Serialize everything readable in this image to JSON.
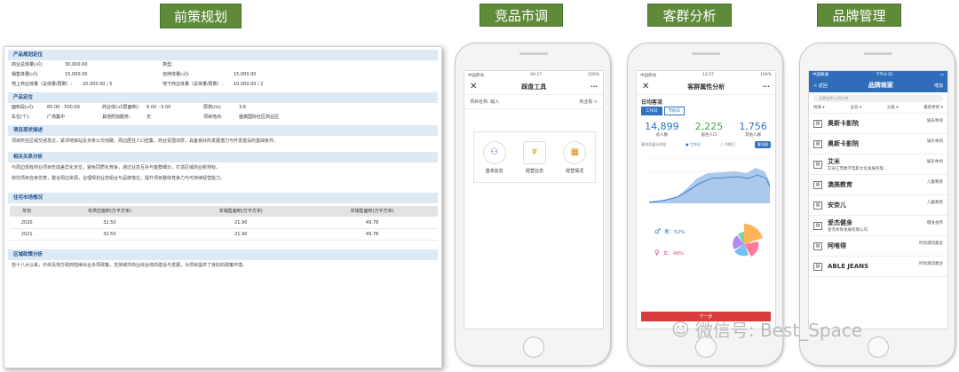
{
  "tags": {
    "t1": "前策规划",
    "t2": "竞品市调",
    "t3": "客群分析",
    "t4": "品牌管理"
  },
  "doc": {
    "sec1": "产品规划定位",
    "r1": [
      "商业总体量(㎡):",
      "30,000.00",
      "类型:",
      ""
    ],
    "r2": [
      "销售体量(㎡):",
      "15,000.00",
      "自持体量(㎡):",
      "15,000.00"
    ],
    "r3": [
      "地上商业体量（总体量/层数）:",
      "20,000.00 / 5",
      "地下商业体量（总体量/层数）:",
      "10,000.00 / 2"
    ],
    "sec2": "产品定位",
    "r4": [
      "面积段(㎡):",
      "60.00 - 500.00",
      "商业体(㎡/层面积):",
      "6.00 - 5.00",
      "层高(m):",
      "3.6"
    ],
    "r5": [
      "车位(个):",
      "广场集中",
      "其他附加服务:",
      "无",
      "项目地点:",
      "盛典国际社区商业区"
    ],
    "sec3": "项目现状描述",
    "p1": "项目所在区域交通发达，紧邻地铁站及多条公交线路，周边居住人口密集，商业氛围浓厚，具备良好的发展潜力与开发建设的基础条件。",
    "sec4": "相关关系分析",
    "p2": "与周边现有商业项目形成差异化定位，避免同质化竞争，通过业态互补与客群细分，打造区域商业新地标。",
    "p3": "依托项目自身优势，整合周边资源，合理规划业态组合与品牌落位，提升项目整体竞争力与可持续经营能力。",
    "sec5": "住宅市场情况",
    "table": {
      "headers": [
        "年份",
        "年供应面积(万平方米)",
        "年销售面积(万平方米)",
        "年销售面积(万平方米)"
      ],
      "rows": [
        [
          "2020",
          "32.50",
          "21.90",
          "49.78"
        ],
        [
          "2021",
          "32.50",
          "21.90",
          "49.78"
        ]
      ]
    },
    "sec6": "区域政策分析",
    "p4": "自十八大以来，中央及地方政府陆续出台多项政策，支持城市商业综合体的建设与发展，为项目提供了良好的政策环境。"
  },
  "s1": {
    "carrier": "中国移动",
    "time": "00:17",
    "battery": "100%",
    "title": "踩盘工具",
    "more": "···",
    "field_label": "项目名称: 输入",
    "field_value": "商业街 >",
    "tiles": [
      "基本信息",
      "经营业态",
      "经营情况"
    ]
  },
  "s2": {
    "carrier": "中国移动",
    "time": "12:57",
    "battery": "100%",
    "title": "客群属性分析",
    "more": "···",
    "subtitle": "日均客流",
    "tabs": [
      "工作日",
      "节假日"
    ],
    "kpis": [
      {
        "value": "14,899",
        "label": "总人数"
      },
      {
        "value": "2,225",
        "label": "居住人口"
      },
      {
        "value": "1,756",
        "label": "其他人群"
      }
    ],
    "legend_label": "客流总量分时段",
    "legend_items": [
      "工作日",
      "节假日"
    ],
    "pill": "客流量",
    "male": "男：52%",
    "female": "女：48%",
    "next": "下一步",
    "colors": {
      "blue": "#2d73c2",
      "green": "#4aa64a",
      "red": "#d93c3c"
    }
  },
  "s3": {
    "carrier": "中国联通",
    "time": "下午4:35",
    "back": "< 返回",
    "title": "品牌商家",
    "add": "增加",
    "search": "品牌名称/公司名称",
    "filters": [
      "地域 ▾",
      "业态 ▾",
      "分类 ▾",
      "最新更新 ▾"
    ],
    "brands": [
      {
        "name": "奥斯卡影院",
        "sub": "",
        "cat": "娱乐休闲"
      },
      {
        "name": "奥斯卡影院",
        "sub": "",
        "cat": "娱乐休闲"
      },
      {
        "name": "艾米",
        "sub": "艾米江苏数学电影文化发展有限...",
        "cat": "娱乐休闲"
      },
      {
        "name": "澳美教育",
        "sub": "",
        "cat": "儿童教育"
      },
      {
        "name": "安奈儿",
        "sub": "",
        "cat": "儿童教育"
      },
      {
        "name": "爱杰健身",
        "sub": "爱杰体育发展有限公司",
        "cat": "健身会所"
      },
      {
        "name": "阿唯得",
        "sub": "",
        "cat": "时尚潮流集合"
      },
      {
        "name": "ABLE JEANS",
        "sub": "",
        "cat": "时尚潮流集合"
      }
    ]
  },
  "watermark": "微信号: Best_Space"
}
